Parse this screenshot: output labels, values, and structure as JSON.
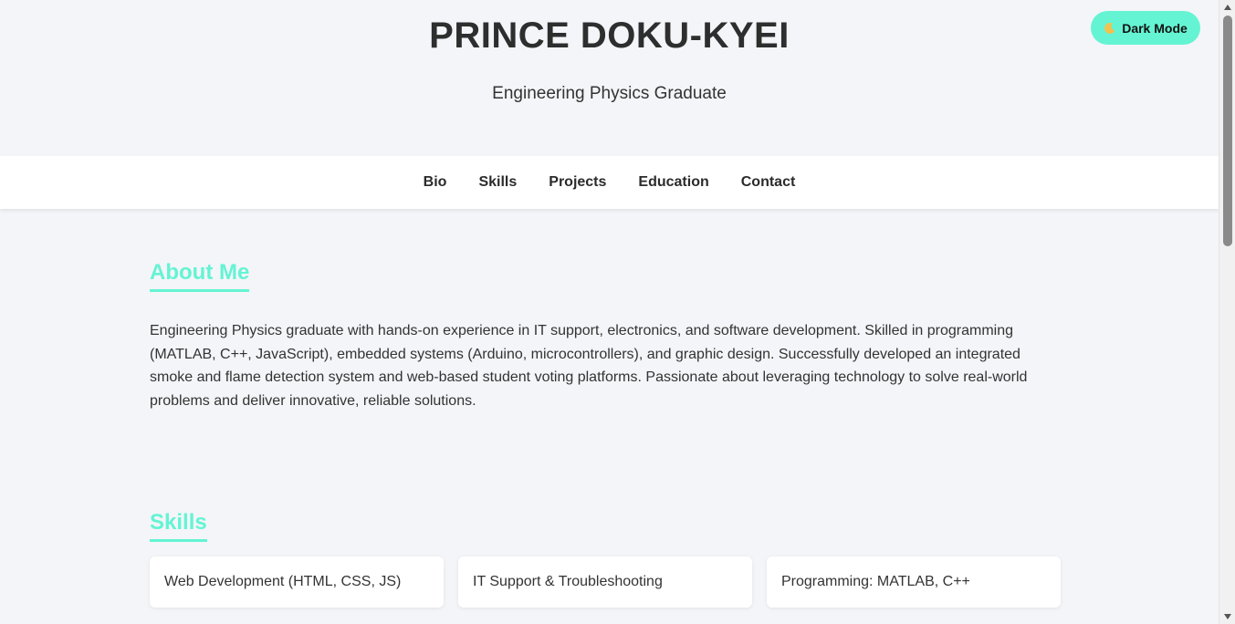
{
  "header": {
    "name": "PRINCE DOKU-KYEI",
    "role": "Engineering Physics Graduate",
    "dark_mode_label": "Dark Mode",
    "dark_mode_icon": "moon-icon"
  },
  "nav": {
    "items": [
      {
        "label": "Bio"
      },
      {
        "label": "Skills"
      },
      {
        "label": "Projects"
      },
      {
        "label": "Education"
      },
      {
        "label": "Contact"
      }
    ]
  },
  "about": {
    "title": "About Me",
    "text": "Engineering Physics graduate with hands-on experience in IT support, electronics, and software development. Skilled in programming (MATLAB, C++, JavaScript), embedded systems (Arduino, microcontrollers), and graphic design. Successfully developed an integrated smoke and flame detection system and web-based student voting platforms. Passionate about leveraging technology to solve real-world problems and deliver innovative, reliable solutions."
  },
  "skills": {
    "title": "Skills",
    "items": [
      {
        "label": "Web Development (HTML, CSS, JS)"
      },
      {
        "label": "IT Support & Troubleshooting"
      },
      {
        "label": "Programming: MATLAB, C++"
      }
    ]
  },
  "colors": {
    "accent": "#64f4d3",
    "background": "#f4f5f9",
    "text": "#2e2e2e"
  }
}
